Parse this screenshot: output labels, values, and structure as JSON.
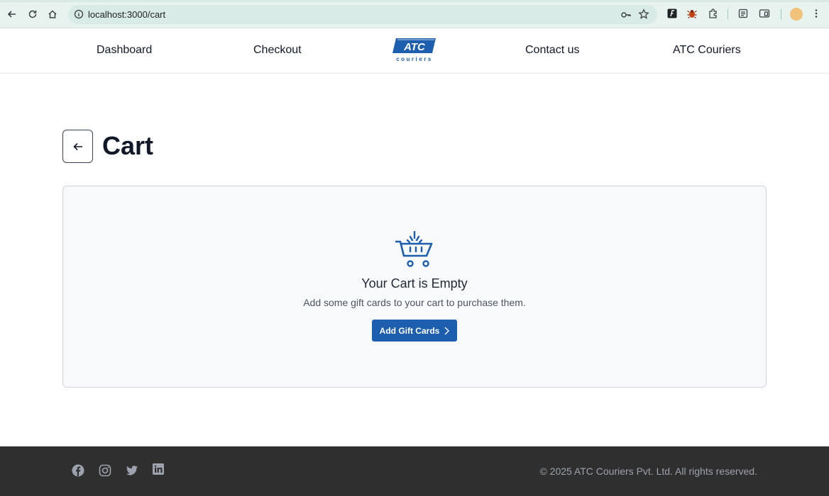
{
  "browser": {
    "url": "localhost:3000/cart"
  },
  "nav": {
    "links": [
      "Dashboard",
      "Checkout",
      "Contact us",
      "ATC Couriers"
    ],
    "logo_text": "ATC",
    "logo_subtext": "couriers"
  },
  "page": {
    "title": "Cart"
  },
  "empty_state": {
    "title": "Your Cart is Empty",
    "subtitle": "Add some gift cards to your cart to purchase them.",
    "button_label": "Add Gift Cards"
  },
  "footer": {
    "copyright": "© 2025 ATC Couriers Pvt. Ltd. All rights reserved.",
    "social": [
      "facebook-icon",
      "instagram-icon",
      "twitter-icon",
      "linkedin-icon"
    ]
  },
  "colors": {
    "brand_blue": "#1d5fae",
    "footer_bg": "#2f2f2f",
    "panel_bg": "#f8f9fb"
  }
}
